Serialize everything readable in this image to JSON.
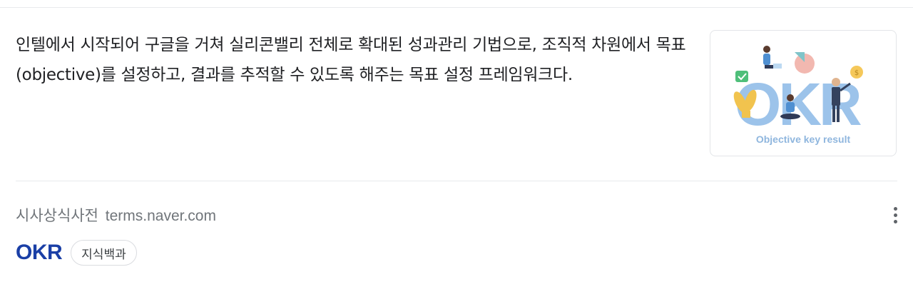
{
  "result": {
    "description": "인텔에서 시작되어 구글을 거쳐 실리콘밸리 전체로 확대된 성과관리 기법으로, 조직적 차원에서 목표(objective)를 설정하고, 결과를 추적할 수 있도록 해주는 목표 설정 프레임워크다.",
    "thumbnail": {
      "logo_text": "OKR",
      "caption": "Objective key result"
    },
    "source": {
      "site_name": "시사상식사전",
      "domain": "terms.naver.com"
    },
    "title": "OKR",
    "tag": "지식백과",
    "more_icon": "more-vertical-icon"
  },
  "colors": {
    "title_link": "#1a3fa6",
    "okr_letters": "#9cc3ea",
    "caption": "#8fb6de"
  }
}
